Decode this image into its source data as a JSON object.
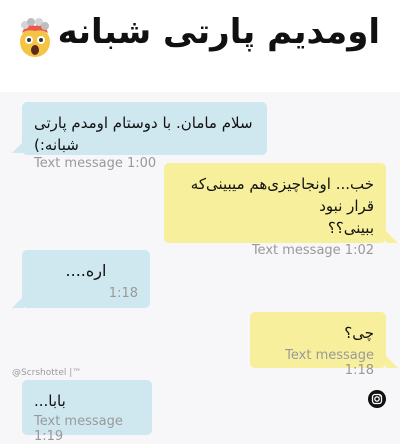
{
  "header": {
    "title": "اومدیم پارتی شبانه",
    "emoji": "exploding-head-emoji"
  },
  "messages": [
    {
      "direction": "incoming",
      "text": "سلام مامان. با دوستام اومدم پارتی شبانه:)",
      "time": "Text message 1:00"
    },
    {
      "direction": "outgoing",
      "text_line1": "خب... اونجاچیزی‌هم میبینی‌که قرار نبود",
      "text_line2": "ببینی؟؟",
      "time": "Text message 1:02"
    },
    {
      "direction": "incoming",
      "text": "اره....",
      "time": "1:18"
    },
    {
      "direction": "outgoing",
      "text": "چی؟",
      "time": "Text message 1:18"
    },
    {
      "direction": "incoming",
      "text": "بابا...",
      "time": "Text message 1:19"
    }
  ],
  "watermark": "@Scrshottel |™",
  "colors": {
    "incoming": "#cfe8f0",
    "outgoing": "#f7ef9c",
    "meta": "#999999"
  },
  "icons": [
    "instagram-icon"
  ]
}
